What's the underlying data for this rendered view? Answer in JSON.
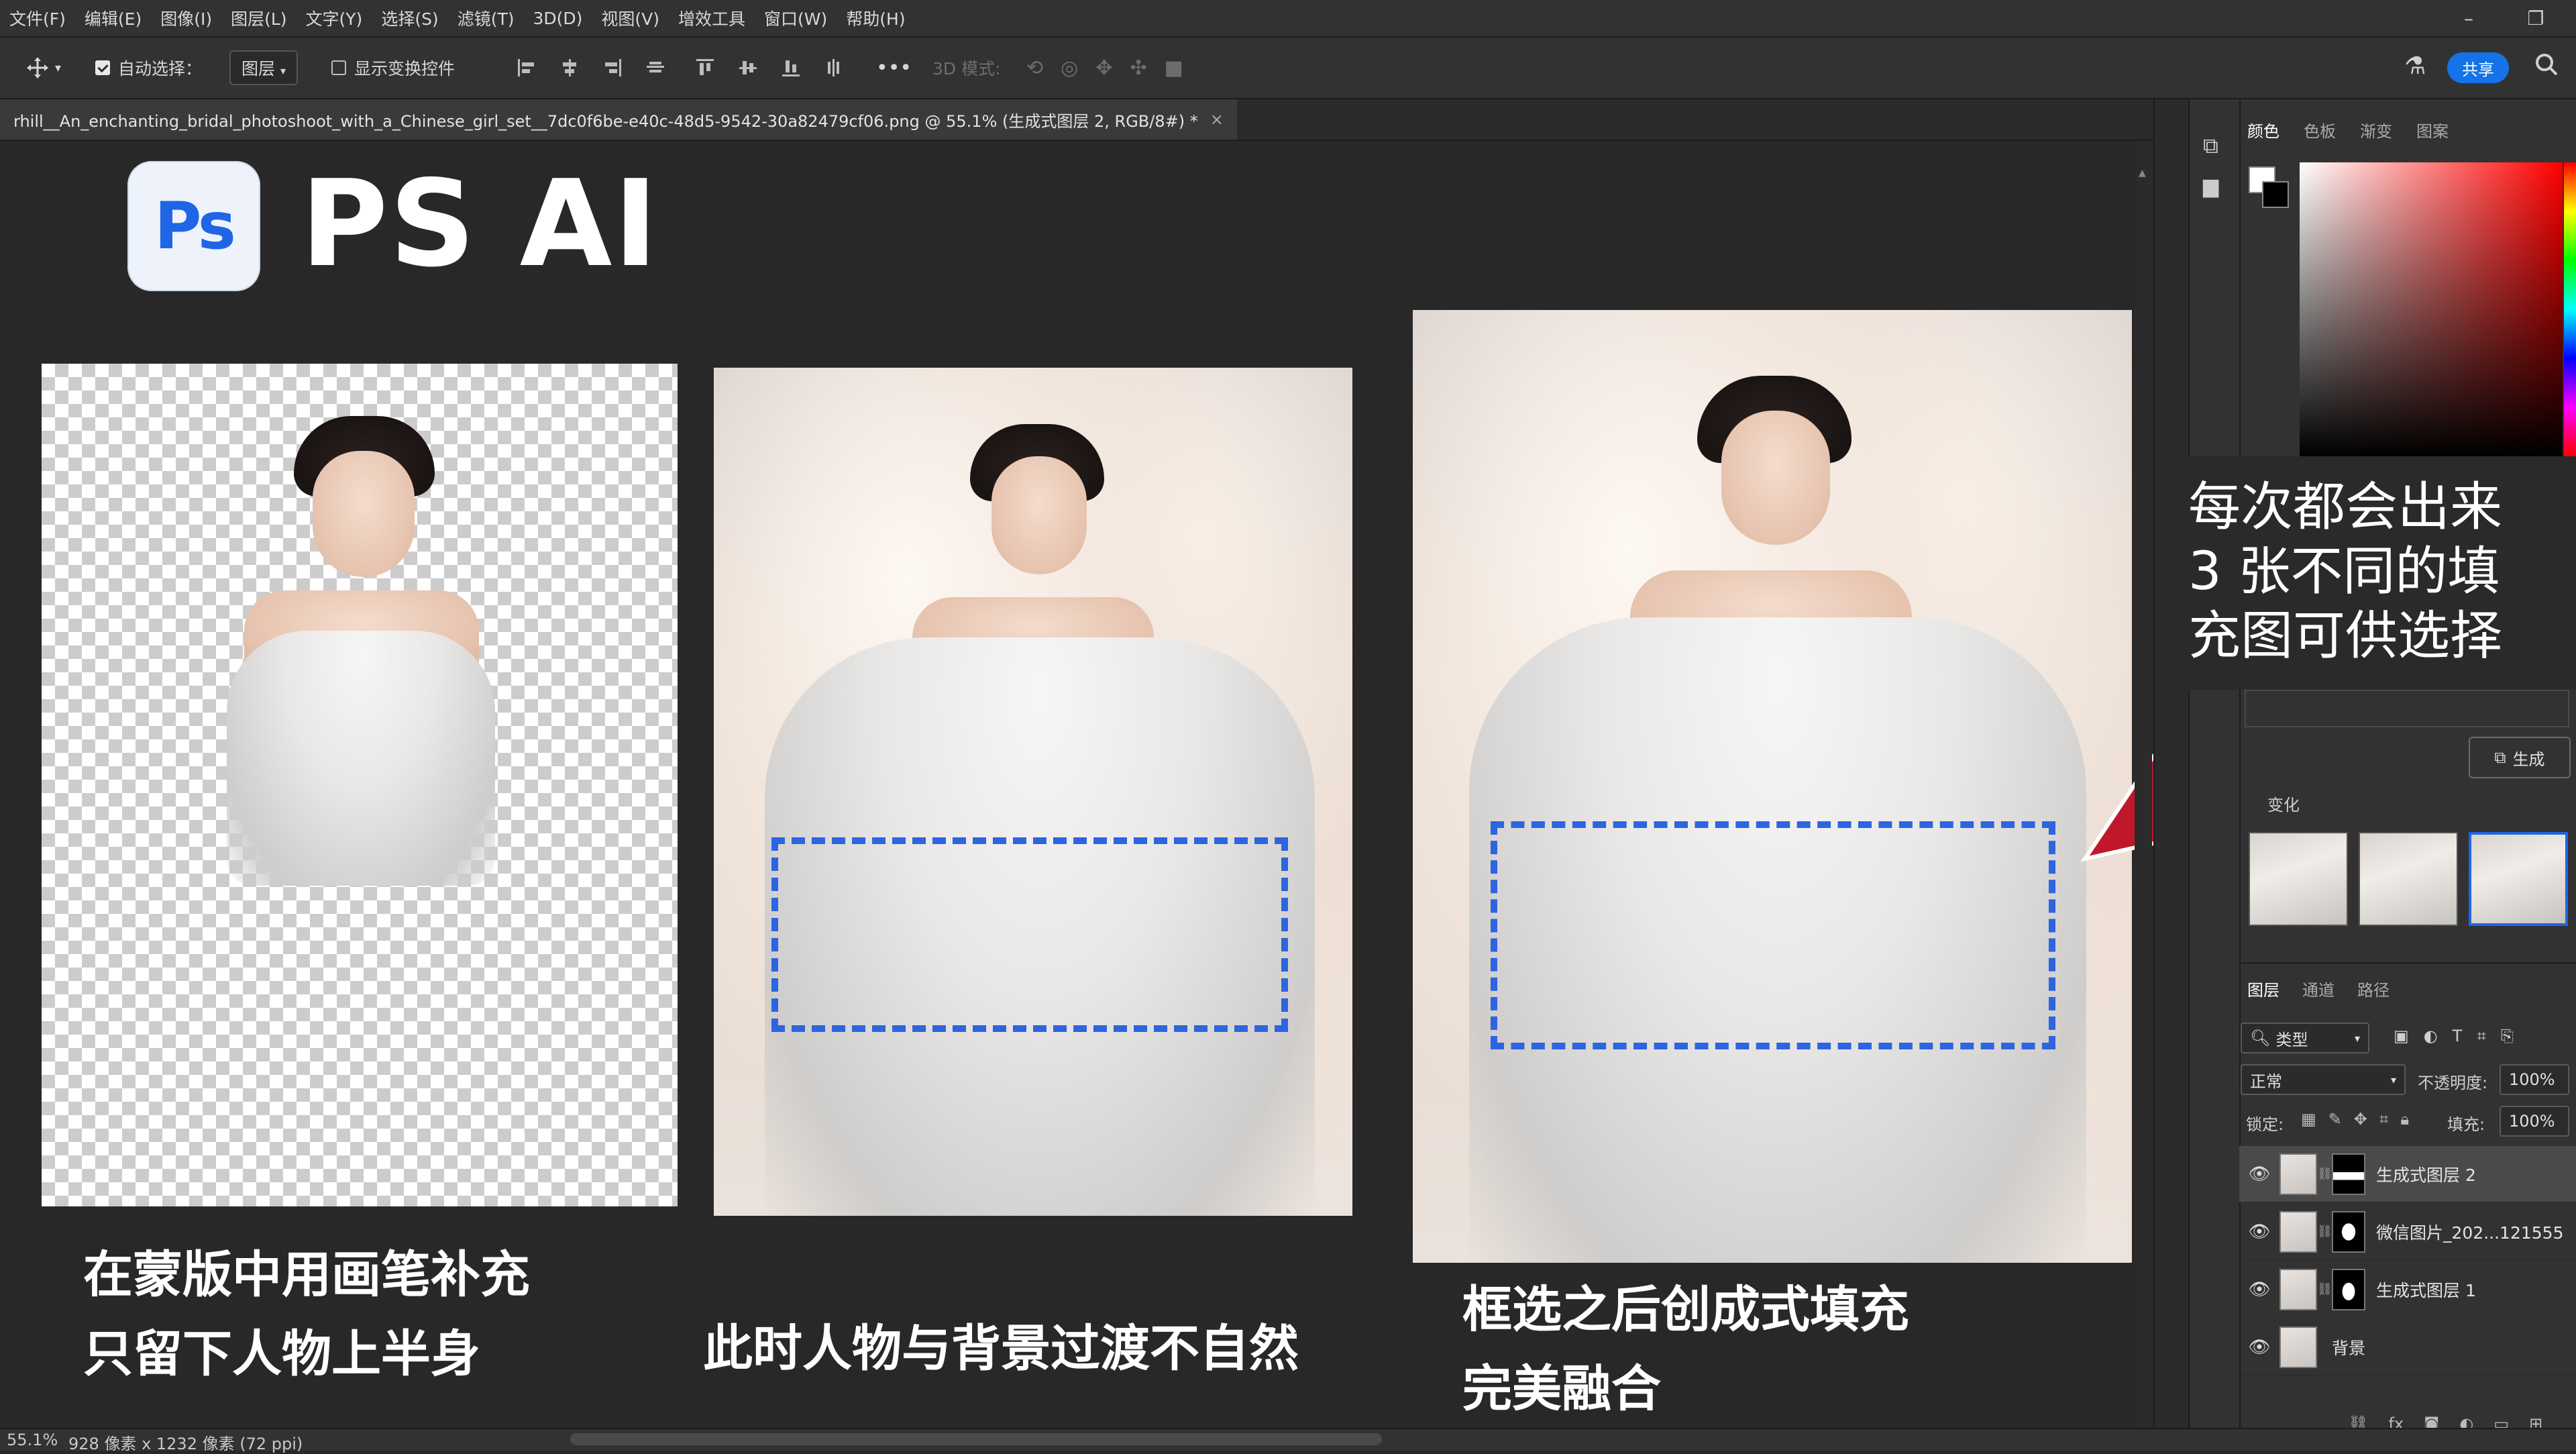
{
  "menu": [
    "文件(F)",
    "编辑(E)",
    "图像(I)",
    "图层(L)",
    "文字(Y)",
    "选择(S)",
    "滤镜(T)",
    "3D(D)",
    "视图(V)",
    "增效工具",
    "窗口(W)",
    "帮助(H)"
  ],
  "options": {
    "auto_select_label": "自动选择：",
    "auto_select_target": "图层",
    "show_transform_label": "显示变换控件",
    "mode_3d_label": "3D 模式:",
    "more": "•••",
    "share_label": "共享"
  },
  "document_tab": {
    "title": "rhill__An_enchanting_bridal_photoshoot_with_a_Chinese_girl_set__7dc0f6be-e40c-48d5-9542-30a82479cf06.png @ 55.1% (生成式图层 2, RGB/8#) *",
    "close": "×"
  },
  "canvas": {
    "logo_text": "Ps",
    "headline": "PS AI",
    "caption_1_line1": "在蒙版中用画笔补充",
    "caption_1_line2": "只留下人物上半身",
    "caption_2": "此时人物与背景过渡不自然",
    "caption_3_line1": "框选之后创成式填充",
    "caption_3_line2": "完美融合"
  },
  "panel": {
    "color_tabs": [
      "颜色",
      "色板",
      "渐变",
      "图案"
    ],
    "callout_lines": [
      "每次都会出来",
      "3 张不同的填",
      "充图可供选择"
    ],
    "generate_label": "生成",
    "variations_label": "变化",
    "layers_tabs": [
      "图层",
      "通道",
      "路径"
    ],
    "filter_kind": "类型",
    "blend_mode": "正常",
    "opacity_label": "不透明度:",
    "opacity_value": "100%",
    "lock_label": "锁定:",
    "fill_label": "填充:",
    "fill_value": "100%",
    "layers": [
      {
        "name": "生成式图层 2",
        "selected": true
      },
      {
        "name": "微信图片_202...121555"
      },
      {
        "name": "生成式图层 1"
      },
      {
        "name": "背景"
      }
    ],
    "accent_color": "#1473e6",
    "selection_color": "#2d64e0",
    "arrow_color": "#c0182a"
  },
  "status": {
    "zoom": "55.1%",
    "doc_info": "928 像素 x 1232 像素 (72 ppi)"
  },
  "window_controls": {
    "minimize": "–",
    "restore": "❐"
  }
}
